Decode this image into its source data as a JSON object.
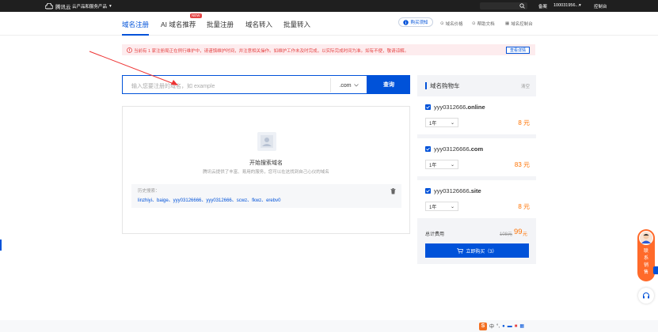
{
  "topbar": {
    "logo_text": "腾讯云",
    "product_menu": "云产品和服务产品",
    "filing": "备案",
    "account": "100031956...",
    "console": "控制台"
  },
  "tabs": [
    {
      "label": "域名注册"
    },
    {
      "label": "AI 域名推荐"
    },
    {
      "label": "批量注册"
    },
    {
      "label": "域名转入"
    },
    {
      "label": "批量转入"
    }
  ],
  "new_badge": "NEW",
  "right_links": {
    "buy_notice": "购买须知",
    "domain_price": "域名价格",
    "help_doc": "帮助文档",
    "domain_console": "域名控制台"
  },
  "notice": {
    "text": "当前有 1 家注册局正在例行维护中，请谨慎维护时间，并注意相关操作。如维护工作未及时完成，以实际完成时间为准。如有不便，敬请谅解。",
    "button": "查看详情"
  },
  "search": {
    "placeholder": "输入您要注册的域名，如 example",
    "suffix": ".com",
    "query_button": "查询"
  },
  "empty_state": {
    "title": "开始搜索域名",
    "subtitle": "腾讯云提供了丰富、易用的服务，您可以在这找到自己心仪的域名"
  },
  "history": {
    "label": "历史搜索：",
    "items": "linzhiyi、baige、yyy03126666、yyy0312666、scwz、fkwz、erebv0"
  },
  "cart": {
    "title": "域名购物车",
    "clear": "清空",
    "items": [
      {
        "prefix": "yyy0312666",
        "suffix": ".online",
        "years": "1年",
        "price": "8 元"
      },
      {
        "prefix": "yyy03126666",
        "suffix": ".com",
        "years": "1年",
        "price": "83 元"
      },
      {
        "prefix": "yyy03126666",
        "suffix": ".site",
        "years": "1年",
        "price": "8 元"
      }
    ],
    "total_label": "总计费用",
    "total_old": "108元",
    "total_new": "99",
    "total_unit": "元",
    "checkout": "立即购买（3）"
  },
  "contact": {
    "text": "联\n系\n销\n售"
  },
  "ime": {
    "s": "S",
    "lang": "中"
  },
  "colors": {
    "primary": "#0052d9",
    "price": "#ff7200",
    "warning": "#e54545"
  }
}
